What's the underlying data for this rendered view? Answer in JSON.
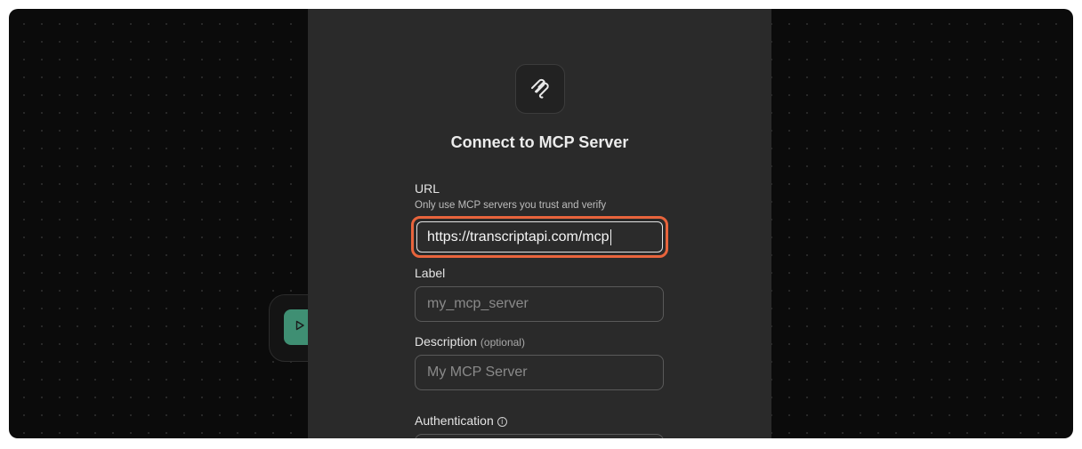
{
  "modal": {
    "logo_icon": "mcp-logo-icon",
    "title": "Connect to MCP Server",
    "url": {
      "label": "URL",
      "hint": "Only use MCP servers you trust and verify",
      "value": "https://transcriptapi.com/mcp"
    },
    "label_field": {
      "label": "Label",
      "placeholder": "my_mcp_server"
    },
    "description_field": {
      "label": "Description",
      "optional": "(optional)",
      "placeholder": "My MCP Server"
    },
    "authentication": {
      "label": "Authentication",
      "info_icon": "info-icon"
    }
  },
  "background": {
    "node_icon": "play-icon"
  },
  "colors": {
    "canvas": "#0b0b0b",
    "modal": "#2a2a2a",
    "highlight": "#e8643c",
    "node_accent": "#3f8f73"
  }
}
